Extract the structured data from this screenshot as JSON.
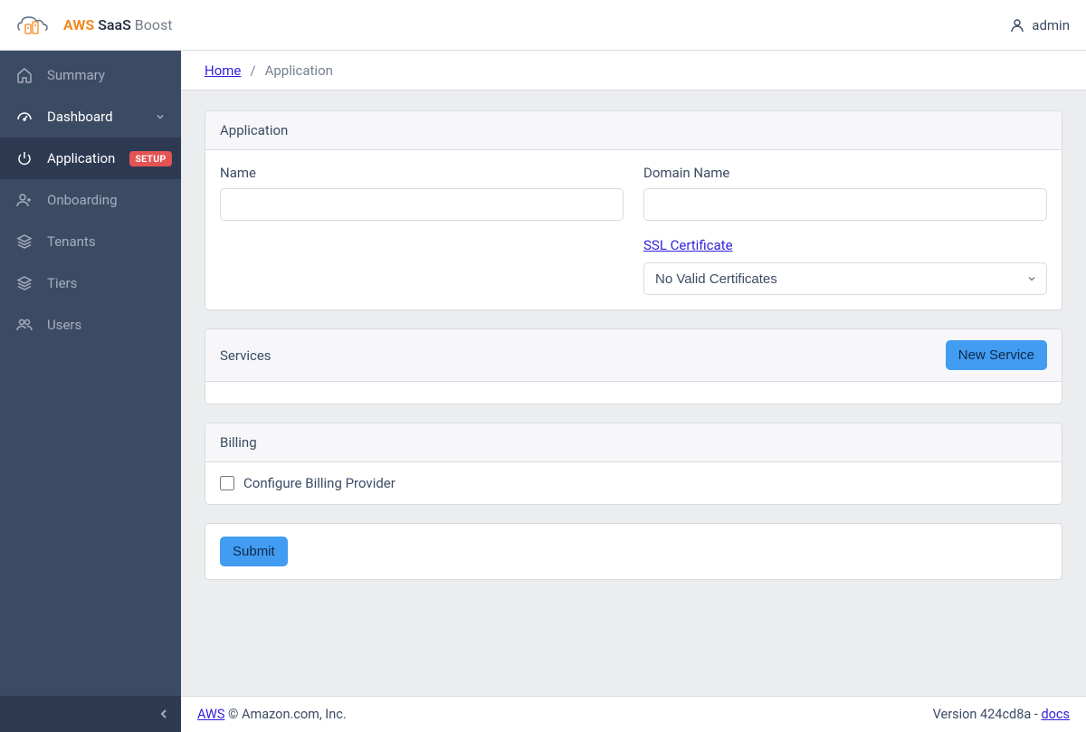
{
  "brand": {
    "aws": "AWS",
    "saas": "SaaS",
    "boost": "Boost"
  },
  "user": {
    "name": "admin"
  },
  "sidebar": {
    "items": [
      {
        "label": "Summary"
      },
      {
        "label": "Dashboard"
      },
      {
        "label": "Application",
        "badge": "SETUP"
      },
      {
        "label": "Onboarding"
      },
      {
        "label": "Tenants"
      },
      {
        "label": "Tiers"
      },
      {
        "label": "Users"
      }
    ]
  },
  "breadcrumb": {
    "home": "Home",
    "current": "Application"
  },
  "application_card": {
    "title": "Application",
    "name_label": "Name",
    "domain_label": "Domain Name",
    "ssl_link": "SSL Certificate",
    "cert_select": "No Valid Certificates"
  },
  "services_card": {
    "title": "Services",
    "new_button": "New Service"
  },
  "billing_card": {
    "title": "Billing",
    "checkbox_label": "Configure Billing Provider"
  },
  "submit_button": "Submit",
  "footer": {
    "aws": "AWS",
    "copyright": " © Amazon.com, Inc.",
    "version_prefix": "Version ",
    "version": "424cd8a",
    "dash": " - ",
    "docs": "docs"
  }
}
